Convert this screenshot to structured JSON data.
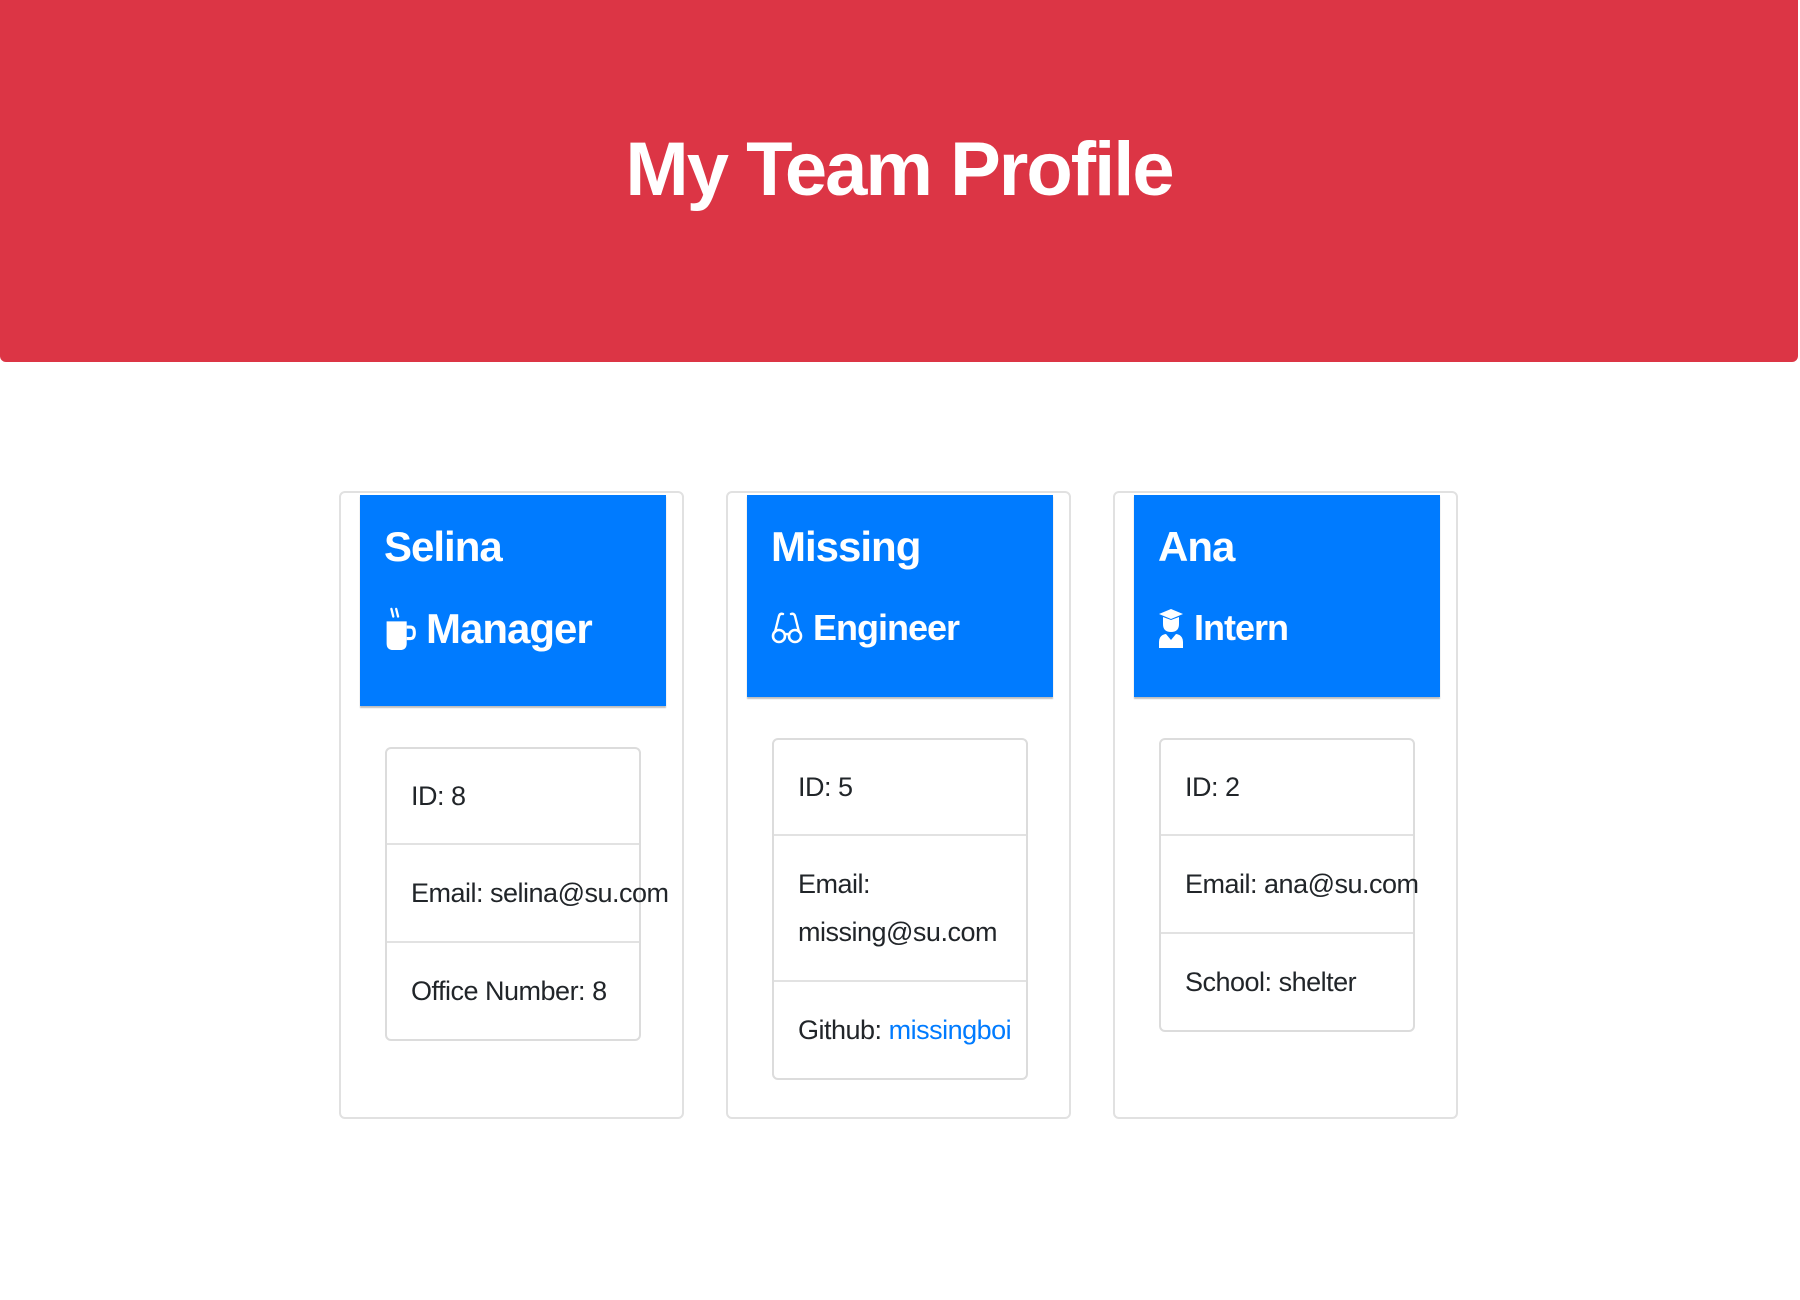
{
  "header": {
    "title": "My Team Profile"
  },
  "colors": {
    "header_bg": "#dc3545",
    "card_header_bg": "#007bff",
    "link": "#007bff"
  },
  "cards": [
    {
      "name": "Selina",
      "role": "Manager",
      "icon": "coffee-mug-icon",
      "details": [
        {
          "label": "ID:",
          "value": "8"
        },
        {
          "label": "Email:",
          "value": "selina@su.com"
        },
        {
          "label": "Office Number:",
          "value": "8"
        }
      ]
    },
    {
      "name": "Missing",
      "role": "Engineer",
      "icon": "glasses-icon",
      "details": [
        {
          "label": "ID:",
          "value": "5"
        },
        {
          "label": "Email:",
          "value": "missing@su.com"
        },
        {
          "label": "Github:",
          "value": "missingboi"
        }
      ]
    },
    {
      "name": "Ana",
      "role": "Intern",
      "icon": "graduate-icon",
      "details": [
        {
          "label": "ID:",
          "value": "2"
        },
        {
          "label": "Email:",
          "value": "ana@su.com"
        },
        {
          "label": "School:",
          "value": "shelter"
        }
      ]
    }
  ]
}
